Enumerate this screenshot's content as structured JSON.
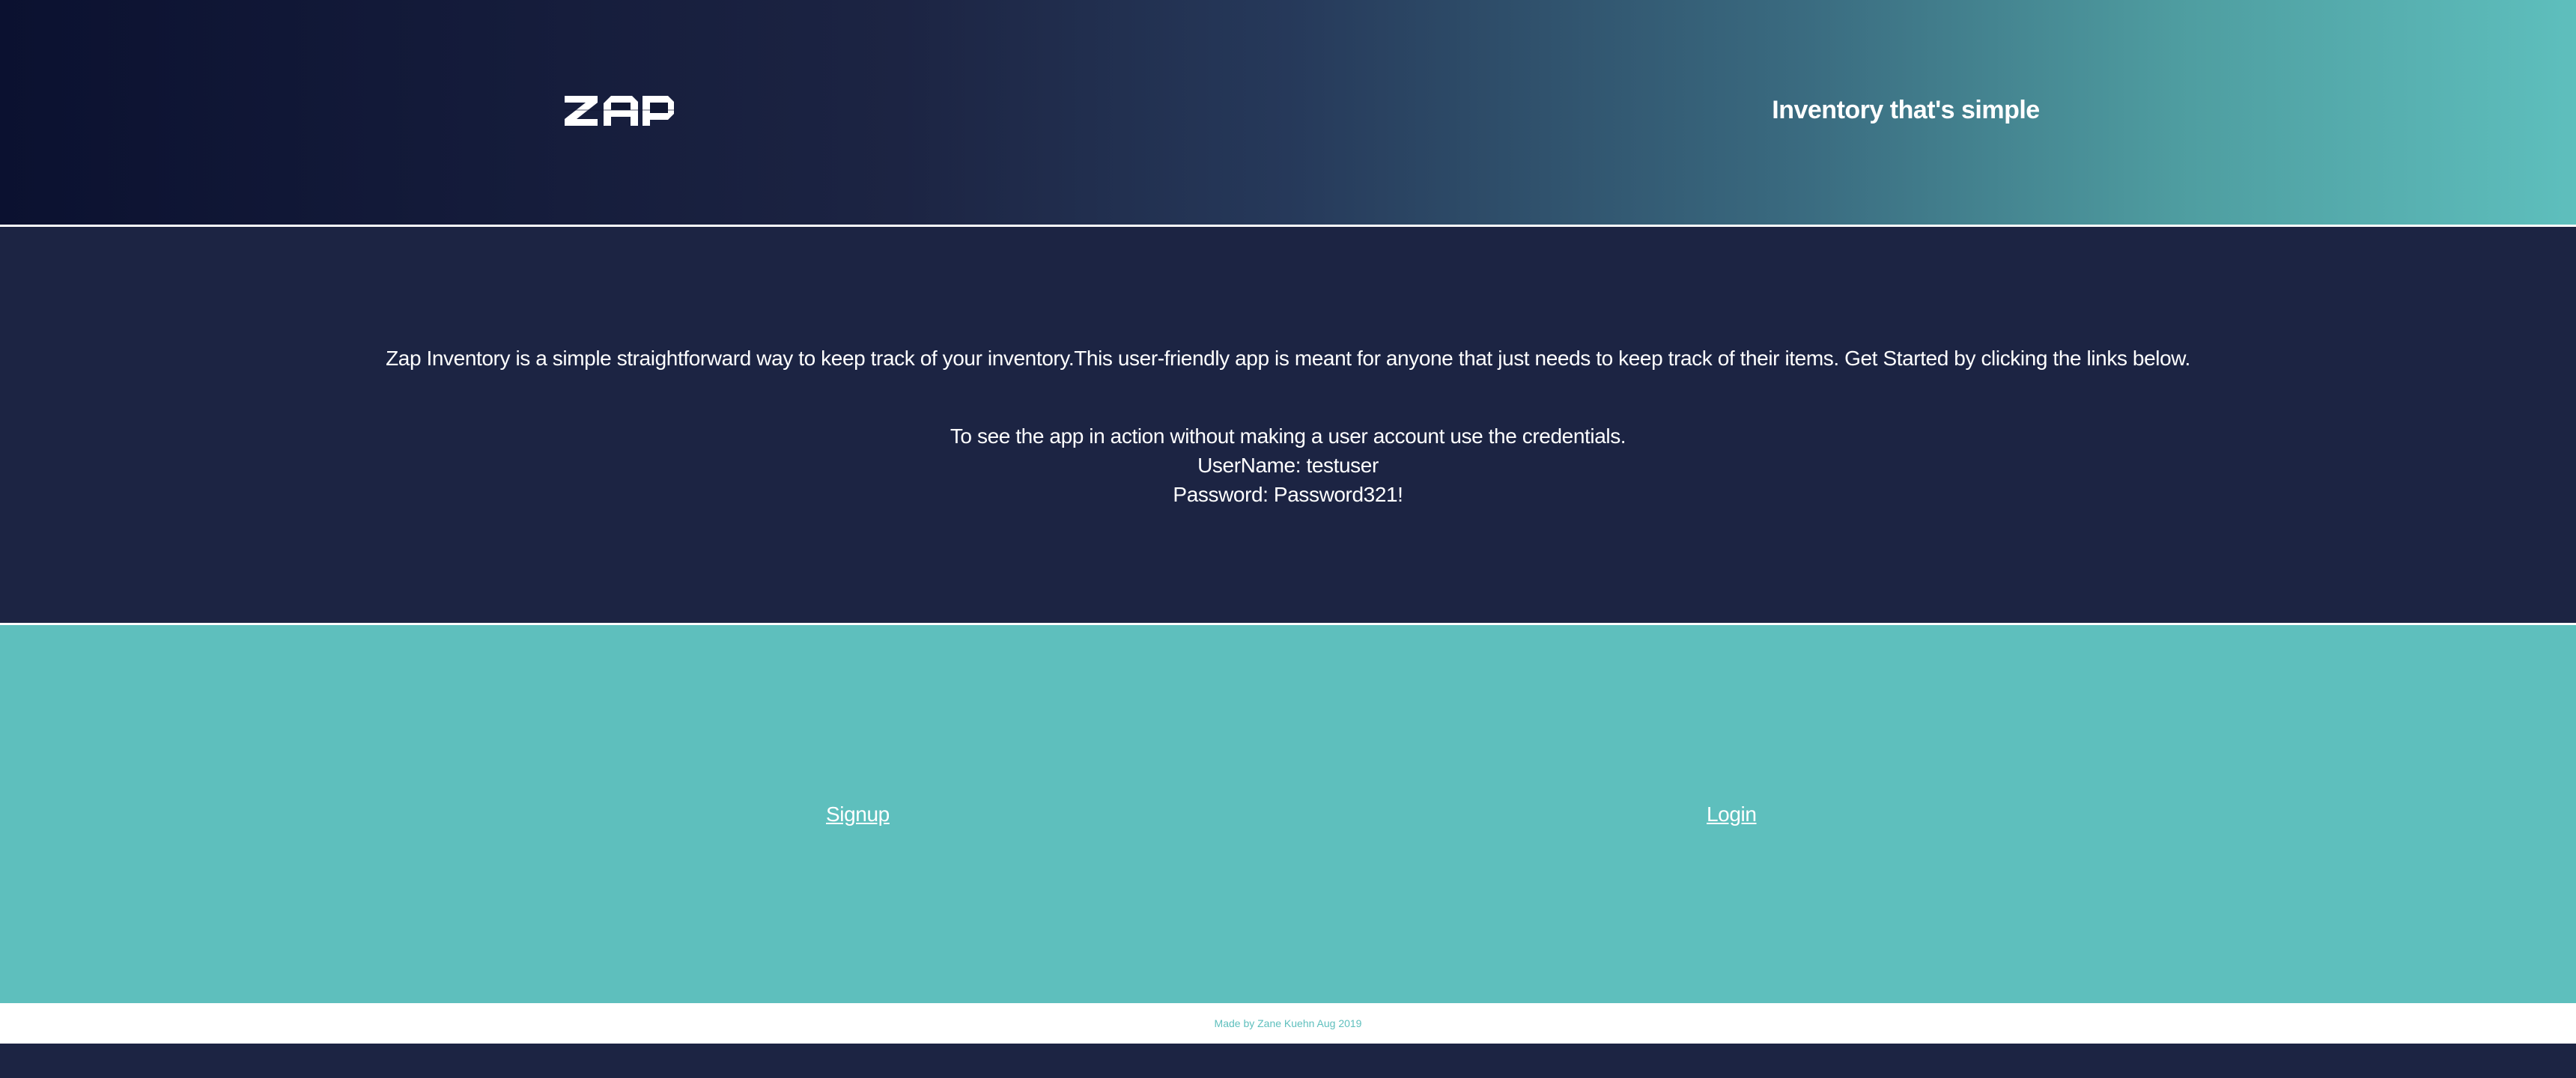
{
  "header": {
    "logo_text": "ZAP",
    "tagline": "Inventory that's simple"
  },
  "intro": {
    "description": "Zap Inventory is a simple straightforward way to keep track of your inventory.This user-friendly app is meant for anyone that just needs to keep track of their items. Get Started by clicking the links below.",
    "credentials_intro": "To see the app in action without making a user account use the credentials.",
    "username_line": "UserName: testuser",
    "password_line": "Password: Password321!"
  },
  "links": {
    "signup_label": "Signup",
    "login_label": "Login"
  },
  "footer": {
    "text": "Made by Zane Kuehn Aug 2019"
  },
  "colors": {
    "navy": "#1c2443",
    "teal": "#5ebfbd",
    "white": "#ffffff"
  }
}
